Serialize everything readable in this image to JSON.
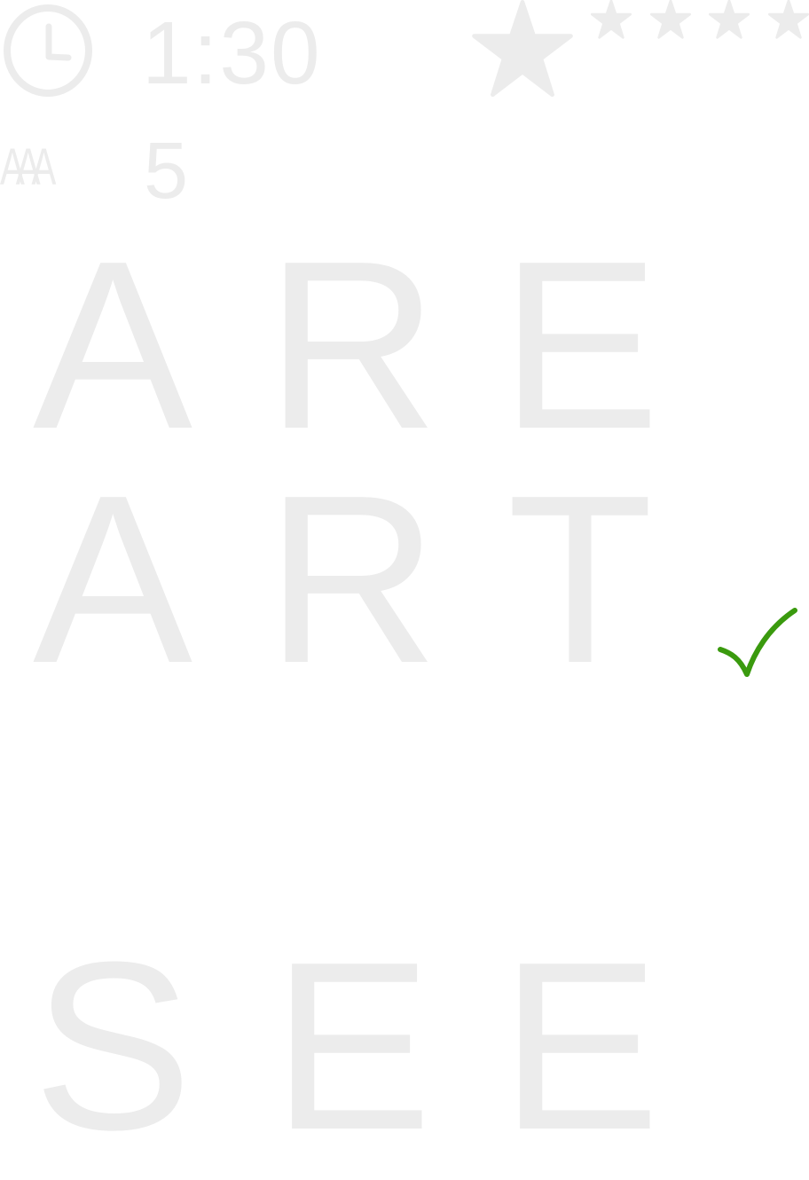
{
  "hud": {
    "timer": "1:30",
    "rating": {
      "earned": 1,
      "total": 5
    },
    "hint_label": "AAA",
    "hint_count": "5",
    "icons": [
      "clock-icon",
      "star-icon",
      "hint-letters-icon",
      "check-icon"
    ]
  },
  "board": {
    "rows": [
      {
        "letters": [
          "A",
          "R",
          "E"
        ],
        "status": ""
      },
      {
        "letters": [
          "A",
          "R",
          "T"
        ],
        "status": "correct"
      },
      {
        "letters": [
          "S",
          "E",
          "E"
        ],
        "status": ""
      }
    ]
  },
  "colors": {
    "letter": "#ececec",
    "hud": "#ececec",
    "check": "#3a9a0e",
    "background": "#ffffff"
  }
}
